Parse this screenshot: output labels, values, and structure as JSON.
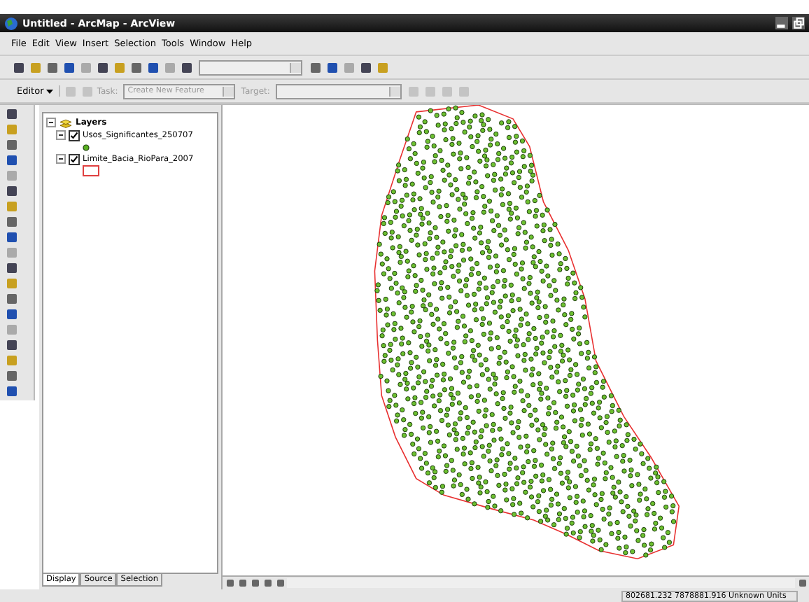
{
  "window": {
    "title": "Untitled - ArcMap - ArcView"
  },
  "menu": [
    "File",
    "Edit",
    "View",
    "Insert",
    "Selection",
    "Tools",
    "Window",
    "Help"
  ],
  "editor_toolbar": {
    "editor": "Editor",
    "task_label": "Task:",
    "task_value": "Create New Feature",
    "target_label": "Target:",
    "disabled": true
  },
  "toc": {
    "title": "Layers",
    "expanded": true,
    "layers": [
      {
        "name": "Usos_Significantes_250707",
        "checked": true,
        "expanded": true,
        "kind": "point"
      },
      {
        "name": "Limite_Bacia_RioPara_2007",
        "checked": true,
        "expanded": true,
        "kind": "polygon"
      }
    ],
    "tabs": [
      {
        "label": "Display",
        "selected": true
      },
      {
        "label": "Source",
        "selected": false
      },
      {
        "label": "Selection",
        "selected": false
      }
    ]
  },
  "status_bar": {
    "coordinates": "802681.232  7878881.916 Unknown Units"
  }
}
